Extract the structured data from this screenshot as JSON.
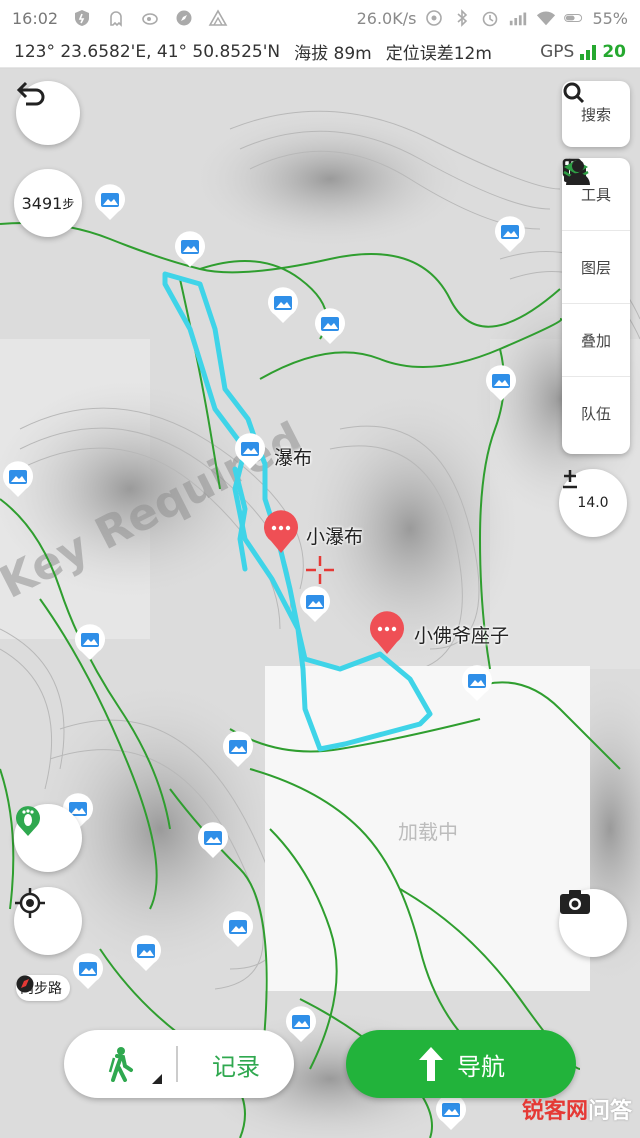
{
  "status_bar": {
    "time": "16:02",
    "network_speed": "26.0K/s",
    "battery": "55%",
    "icons_left": [
      "shield-icon",
      "ghost-icon",
      "weibo-icon",
      "compass-icon",
      "triangle-icon"
    ],
    "icons_right": [
      "location-icon",
      "bluetooth-icon",
      "alarm-icon",
      "hd-signal-icon",
      "wifi-icon",
      "battery-icon"
    ]
  },
  "info_bar": {
    "coordinates": "123° 23.6582'E, 41° 50.8525'N",
    "altitude": "海拔 89m",
    "accuracy": "定位误差12m",
    "gps_label": "GPS",
    "gps_count": "20"
  },
  "controls": {
    "back_icon": "undo-arrow-icon",
    "steps_value": "3491",
    "steps_unit": "步",
    "search_label": "搜索",
    "tools_label": "工具",
    "layers_label": "图层",
    "overlay_label": "叠加",
    "team_label": "队伍",
    "zoom_value": "14.0",
    "footprint_icon": "footprint-icon",
    "locate_icon": "crosshair-locate-icon",
    "compass_label": "两步路",
    "camera_icon": "camera-icon",
    "record_label": "记录",
    "navigate_label": "导航"
  },
  "map": {
    "loading_text": "加载中",
    "watermark_text": "Key Required",
    "pois": [
      "瀑布",
      "小瀑布",
      "小佛爷座子"
    ],
    "track_color": "#3fd4e8",
    "trail_color": "#2f9e2f",
    "poi_pin_color": "#ef4f55"
  },
  "site_watermark": {
    "brand": "锐客网",
    "suffix": "问答"
  }
}
